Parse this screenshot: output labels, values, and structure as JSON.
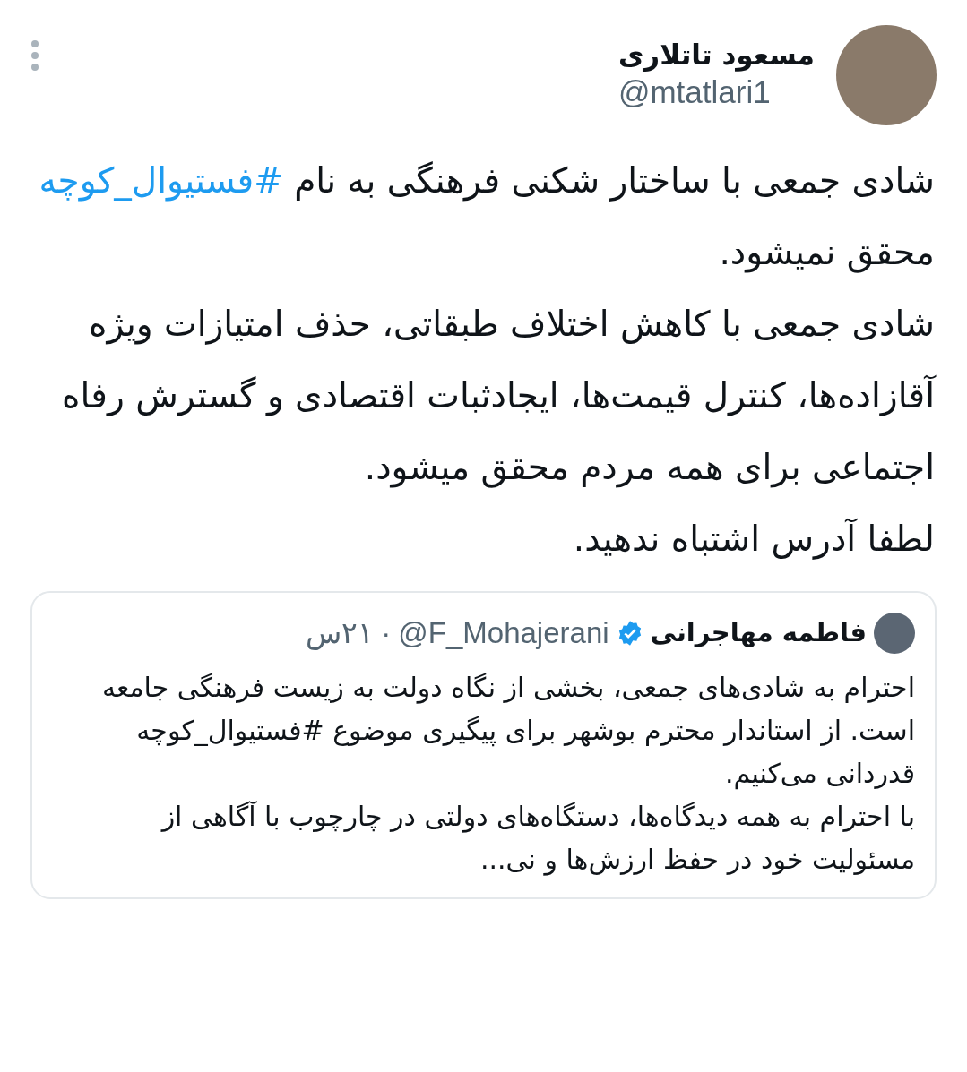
{
  "author": {
    "name": "مسعود تاتلاری",
    "handle": "@mtatlari1"
  },
  "paragraphs": [
    [
      {
        "kind": "text",
        "text": "شادی جمعی با ساختار شکنی فرهنگی به نام "
      },
      {
        "kind": "hashtag",
        "text": "#فستیوال_کوچه"
      },
      {
        "kind": "text",
        "text": " محقق نمیشود."
      }
    ],
    [
      {
        "kind": "text",
        "text": "شادی جمعی با کاهش اختلاف طبقاتی، حذف امتیازات ویژه آقازاده‌ها، کنترل قیمت‌ها، ایجادثبات اقتصادی و گسترش رفاه اجتماعی برای همه مردم محقق میشود."
      }
    ],
    [
      {
        "kind": "text",
        "text": "لطفا آدرس اشتباه ندهید."
      }
    ]
  ],
  "quoted_tweet": {
    "name": "فاطمه مهاجرانی",
    "verified": true,
    "handle": "@F_Mohajerani",
    "separator": "·",
    "time": "۲۱س",
    "paragraphs": [
      "احترام به شادی‌های جمعی، بخشی از نگاه دولت به زیست فرهنگی جامعه است. از استاندار محترم بوشهر برای پیگیری موضوع #فستیوال_کوچه قدردانی می‌کنیم.",
      "با احترام به همه دیدگاه‌ها، دستگاه‌های دولتی در چارچوب با آگاهی از مسئولیت خود در حفظ ارزش‌ها و نی..."
    ]
  }
}
